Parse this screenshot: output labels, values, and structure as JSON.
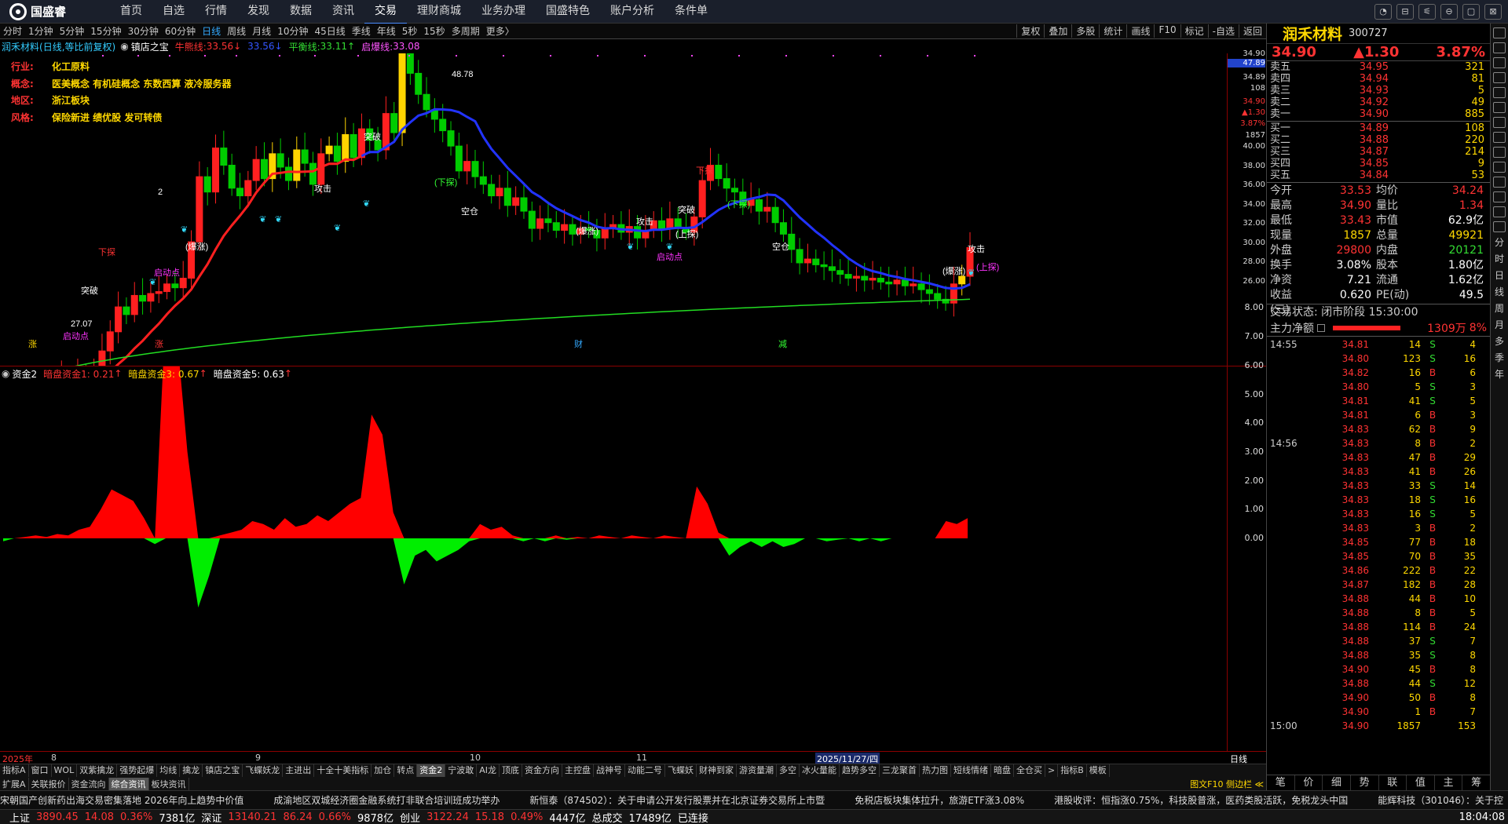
{
  "app": {
    "brand": "国盛睿"
  },
  "menu": [
    "首页",
    "自选",
    "行情",
    "发现",
    "数据",
    "资讯",
    "交易",
    "理财商城",
    "业务办理",
    "国盛特色",
    "账户分析",
    "条件单"
  ],
  "window_controls": [
    "◔",
    "⊟",
    "⚟",
    "⊖",
    "▢",
    "⊠"
  ],
  "periods": [
    "分时",
    "1分钟",
    "5分钟",
    "15分钟",
    "30分钟",
    "60分钟",
    "日线",
    "周线",
    "月线",
    "10分钟",
    "45日线",
    "季线",
    "年线",
    "5秒",
    "15秒",
    "多周期",
    "更多〉"
  ],
  "active_period": "日线",
  "right_tools": [
    "复权",
    "叠加",
    "多股",
    "统计",
    "画线",
    "F10",
    "标记",
    "-自选",
    "返回"
  ],
  "info": {
    "stock": "润禾材料",
    "mode": "(日线,等比前复权)",
    "indicator": "镇店之宝",
    "l1": "牛熊线:",
    "v1": "33.56",
    "a1": "↓",
    "v2": "33.56",
    "a2": "↓",
    "l3": "平衡线:",
    "v3": "33.11",
    "a3": "↑",
    "l4": "启爆线:",
    "v4": "33.08"
  },
  "profile": [
    {
      "k": "行业:",
      "v": "化工原料"
    },
    {
      "k": "概念:",
      "v": "医美概念 有机硅概念 东数西算 液冷服务器"
    },
    {
      "k": "地区:",
      "v": "浙江板块"
    },
    {
      "k": "风格:",
      "v": "保险新进 绩优股 发可转债"
    }
  ],
  "main_labels": {
    "high": "48.78",
    "low": "27.07",
    "baozhang": "(爆涨)",
    "xiatan": "下探",
    "shangtan": "(上探)",
    "xiatan2": "(下探)",
    "kongcang": "空仓",
    "jingong": "攻击",
    "qidong": "启动点",
    "tupo": "突破",
    "n2": "2",
    "ma_label": "(上探)"
  },
  "bottom_marks": [
    "涨",
    "涨",
    "财",
    "减"
  ],
  "price_axis": [
    "34.90",
    "47.89",
    "34.89",
    "108",
    "34.90",
    "▲1.30",
    "3.87%",
    "1857",
    "40.00",
    "38.00",
    "36.00",
    "34.00",
    "32.00",
    "30.00",
    "28.00",
    "26.00"
  ],
  "ind2": {
    "name": "资金2",
    "l1": "暗盘资金1: 0.21",
    "a1": "↑",
    "l3": "暗盘资金3: 0.67",
    "a3": "↑",
    "l5": "暗盘资金5: 0.63",
    "a5": "↑"
  },
  "ind2_axis": [
    "8.00",
    "7.00",
    "6.00",
    "5.00",
    "4.00",
    "3.00",
    "2.00",
    "1.00",
    "0.00"
  ],
  "dates": [
    "2025年",
    "8",
    "9",
    "10",
    "11",
    "2025/11/27/四"
  ],
  "period_tag": "日线",
  "tabs": [
    "指标A",
    "窗口",
    "WOL",
    "双紫擒龙",
    "强势起爆",
    "均线",
    "擒龙",
    "镇店之宝",
    "飞蝶妖龙",
    "主进出",
    "十全十美指标",
    "加仓",
    "转点",
    "资金2",
    "宁波敢",
    "AI龙",
    "顶底",
    "资金方向",
    "主控盘",
    "战神号",
    "动能二号",
    "飞蝶妖",
    "财神到家",
    "游资量潮",
    "多空",
    "冰火量能",
    "趋势多空",
    "三龙聚首",
    "热力图",
    "短线情绪",
    "暗盘",
    "全仓买",
    ">",
    "指标B",
    "模板"
  ],
  "active_tab": "资金2",
  "tabs2": [
    "扩展A",
    "关联报价",
    "资金流向",
    "综合资讯",
    "板块资讯"
  ],
  "active_tab2": "综合资讯",
  "tabs2_right": "图文F10 侧边栏 ≪",
  "news": [
    "宋朝国产创新药出海交易密集落地 2026年向上趋势中价值",
    "成渝地区双城经济圈金融系统打非联合培训班成功举办",
    "新恒泰（874502）：关于申请公开发行股票并在北京证券交易所上市暨",
    "免税店板块集体拉升，旅游ETF涨3.08%",
    "港股收评：恒指涨0.75%，科技股普涨，医药类股活跃，免税龙头中国",
    "能辉科技（301046）：关于控"
  ],
  "status": [
    {
      "t": "上证",
      "c": "white"
    },
    {
      "t": "3890.45",
      "c": "red"
    },
    {
      "t": "14.08",
      "c": "red"
    },
    {
      "t": "0.36%",
      "c": "red"
    },
    {
      "t": "7381亿",
      "c": "white"
    },
    {
      "t": "深证",
      "c": "white"
    },
    {
      "t": "13140.21",
      "c": "red"
    },
    {
      "t": "86.24",
      "c": "red"
    },
    {
      "t": "0.66%",
      "c": "red"
    },
    {
      "t": "9878亿",
      "c": "white"
    },
    {
      "t": "创业",
      "c": "white"
    },
    {
      "t": "3122.24",
      "c": "red"
    },
    {
      "t": "15.18",
      "c": "red"
    },
    {
      "t": "0.49%",
      "c": "red"
    },
    {
      "t": "4447亿",
      "c": "white"
    },
    {
      "t": "总成交",
      "c": "white"
    },
    {
      "t": "17489亿",
      "c": "white"
    },
    {
      "t": "已连接",
      "c": "white"
    }
  ],
  "clock": "18:04:08",
  "quote": {
    "name": "润禾材料",
    "code": "300727",
    "price": "34.90",
    "change": "▲1.30",
    "pct": "3.87%"
  },
  "sells": [
    {
      "l": "卖五",
      "p": "34.95",
      "v": "321"
    },
    {
      "l": "卖四",
      "p": "34.94",
      "v": "81"
    },
    {
      "l": "卖三",
      "p": "34.93",
      "v": "5"
    },
    {
      "l": "卖二",
      "p": "34.92",
      "v": "49"
    },
    {
      "l": "卖一",
      "p": "34.90",
      "v": "885"
    }
  ],
  "buys": [
    {
      "l": "买一",
      "p": "34.89",
      "v": "108"
    },
    {
      "l": "买二",
      "p": "34.88",
      "v": "220"
    },
    {
      "l": "买三",
      "p": "34.87",
      "v": "214"
    },
    {
      "l": "买四",
      "p": "34.85",
      "v": "9"
    },
    {
      "l": "买五",
      "p": "34.84",
      "v": "53"
    }
  ],
  "stats": [
    {
      "a": "今开",
      "b": "33.53",
      "bc": "red",
      "c": "均价",
      "d": "34.24",
      "dc": "red"
    },
    {
      "a": "最高",
      "b": "34.90",
      "bc": "red",
      "c": "量比",
      "d": "1.34",
      "dc": "red"
    },
    {
      "a": "最低",
      "b": "33.43",
      "bc": "red",
      "c": "市值",
      "d": "62.9亿",
      "dc": "white"
    },
    {
      "a": "现量",
      "b": "1857",
      "bc": "yellow",
      "c": "总量",
      "d": "49921",
      "dc": "yellow"
    },
    {
      "a": "外盘",
      "b": "29800",
      "bc": "red",
      "c": "内盘",
      "d": "20121",
      "dc": "green"
    },
    {
      "a": "换手",
      "b": "3.08%",
      "bc": "white",
      "c": "股本",
      "d": "1.80亿",
      "dc": "white"
    },
    {
      "a": "净资",
      "b": "7.21",
      "bc": "white",
      "c": "流通",
      "d": "1.62亿",
      "dc": "white"
    },
    {
      "a": "收益(三)",
      "b": "0.620",
      "bc": "white",
      "c": "PE(动)",
      "d": "49.5",
      "dc": "white"
    }
  ],
  "trade_state": "交易状态: 闭市阶段 15:30:00",
  "main_flow": {
    "label": "主力净额",
    "value": "1309万",
    "pct": "8%"
  },
  "ticks": [
    {
      "t": "14:55",
      "p": "34.81",
      "v": "14",
      "s": "S",
      "n": "4"
    },
    {
      "t": "",
      "p": "34.80",
      "v": "123",
      "s": "S",
      "n": "16"
    },
    {
      "t": "",
      "p": "34.82",
      "v": "16",
      "s": "B",
      "n": "6"
    },
    {
      "t": "",
      "p": "34.80",
      "v": "5",
      "s": "S",
      "n": "3"
    },
    {
      "t": "",
      "p": "34.81",
      "v": "41",
      "s": "S",
      "n": "5"
    },
    {
      "t": "",
      "p": "34.81",
      "v": "6",
      "s": "B",
      "n": "3"
    },
    {
      "t": "",
      "p": "34.83",
      "v": "62",
      "s": "B",
      "n": "9"
    },
    {
      "t": "14:56",
      "p": "34.83",
      "v": "8",
      "s": "B",
      "n": "2"
    },
    {
      "t": "",
      "p": "34.83",
      "v": "47",
      "s": "B",
      "n": "29"
    },
    {
      "t": "",
      "p": "34.83",
      "v": "41",
      "s": "B",
      "n": "26"
    },
    {
      "t": "",
      "p": "34.83",
      "v": "33",
      "s": "S",
      "n": "14"
    },
    {
      "t": "",
      "p": "34.83",
      "v": "18",
      "s": "S",
      "n": "16"
    },
    {
      "t": "",
      "p": "34.83",
      "v": "16",
      "s": "S",
      "n": "5"
    },
    {
      "t": "",
      "p": "34.83",
      "v": "3",
      "s": "B",
      "n": "2"
    },
    {
      "t": "",
      "p": "34.85",
      "v": "77",
      "s": "B",
      "n": "18"
    },
    {
      "t": "",
      "p": "34.85",
      "v": "70",
      "s": "B",
      "n": "35"
    },
    {
      "t": "",
      "p": "34.86",
      "v": "222",
      "s": "B",
      "n": "22"
    },
    {
      "t": "",
      "p": "34.87",
      "v": "182",
      "s": "B",
      "n": "28"
    },
    {
      "t": "",
      "p": "34.88",
      "v": "44",
      "s": "B",
      "n": "10"
    },
    {
      "t": "",
      "p": "34.88",
      "v": "8",
      "s": "B",
      "n": "5"
    },
    {
      "t": "",
      "p": "34.88",
      "v": "114",
      "s": "B",
      "n": "24"
    },
    {
      "t": "",
      "p": "34.88",
      "v": "37",
      "s": "S",
      "n": "7"
    },
    {
      "t": "",
      "p": "34.88",
      "v": "35",
      "s": "S",
      "n": "8"
    },
    {
      "t": "",
      "p": "34.90",
      "v": "45",
      "s": "B",
      "n": "8"
    },
    {
      "t": "",
      "p": "34.88",
      "v": "44",
      "s": "S",
      "n": "12"
    },
    {
      "t": "",
      "p": "34.90",
      "v": "50",
      "s": "B",
      "n": "8"
    },
    {
      "t": "",
      "p": "34.90",
      "v": "1",
      "s": "B",
      "n": "7"
    },
    {
      "t": "15:00",
      "p": "34.90",
      "v": "1857",
      "s": "",
      "n": "153"
    }
  ],
  "rbottom": [
    "笔",
    "价",
    "细",
    "势",
    "联",
    "值",
    "主",
    "筹"
  ],
  "vside": [
    "分",
    "时",
    "日",
    "线",
    "周",
    "月",
    "多",
    "季",
    "年"
  ],
  "colors": {
    "up": "#ff0000",
    "down": "#00ee00",
    "ma_red": "#ff2020",
    "ma_blue": "#2233ff",
    "ma_green": "#22dd22",
    "accent": "#33aaff"
  }
}
